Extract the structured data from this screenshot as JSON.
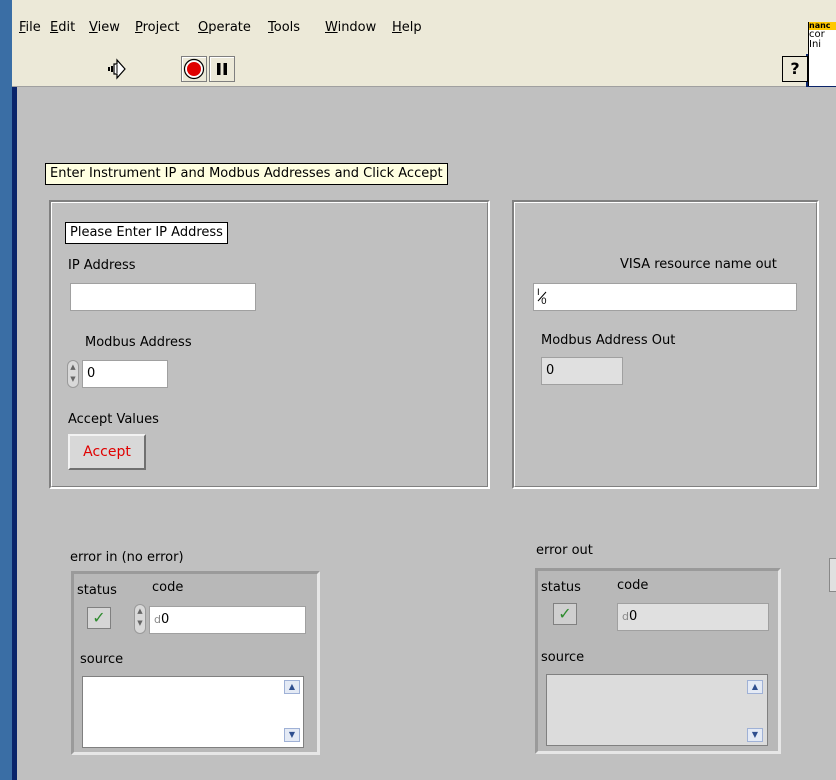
{
  "menu": {
    "file": "File",
    "edit": "Edit",
    "view": "View",
    "project": "Project",
    "operate": "Operate",
    "tools": "Tools",
    "window": "Window",
    "help": "Help"
  },
  "toolbar": {
    "run_icon": "run-arrow-icon",
    "abort_icon": "abort-stop-icon",
    "pause_icon": "pause-icon",
    "help_icon": "context-help-icon",
    "help_glyph": "?"
  },
  "context_help_snippet": {
    "line1": "nanc",
    "line2": "cor",
    "line3": "Ini"
  },
  "banner": "Enter Instrument IP and Modbus Addresses and Click Accept",
  "left_panel": {
    "prompt": "Please Enter IP Address",
    "ip_label": "IP Address",
    "ip_value": "",
    "modbus_label": "Modbus Address",
    "modbus_value": "0",
    "accept_label": "Accept Values",
    "accept_button": "Accept"
  },
  "right_panel": {
    "visa_label": "VISA resource name out",
    "visa_prefix": "I/O",
    "visa_value": "",
    "modbus_out_label": "Modbus Address Out",
    "modbus_out_value": "0"
  },
  "error_in": {
    "title": "error in (no error)",
    "status_label": "status",
    "code_label": "code",
    "code_radix": "d",
    "code_value": "0",
    "source_label": "source",
    "source_value": ""
  },
  "error_out": {
    "title": "error out",
    "status_label": "status",
    "code_label": "code",
    "code_radix": "d",
    "code_value": "0",
    "source_label": "source",
    "source_value": ""
  },
  "colors": {
    "panel_bg": "#c0c0c0",
    "window_frame": "#0a246a",
    "accept_text": "#e00000",
    "banner_bg": "#ffffe1",
    "check_green": "#2e8b2e"
  }
}
